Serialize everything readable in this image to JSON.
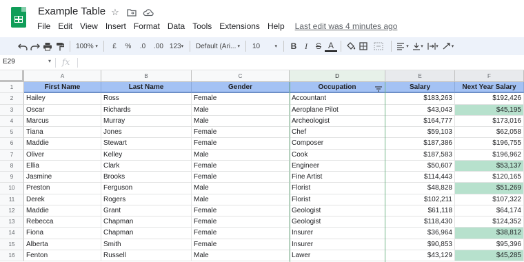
{
  "app": {
    "title": "Example Table",
    "menus": [
      "File",
      "Edit",
      "View",
      "Insert",
      "Format",
      "Data",
      "Tools",
      "Extensions",
      "Help"
    ],
    "last_edit": "Last edit was 4 minutes ago"
  },
  "toolbar": {
    "zoom": "100%",
    "currency": "£",
    "percent": "%",
    "dec_decrease": ".0",
    "dec_increase": ".00",
    "format_more": "123",
    "font": "Default (Ari...",
    "font_size": "10",
    "bold": "B",
    "italic": "I",
    "strike": "S",
    "text_color": "A"
  },
  "formula": {
    "name_box": "E29",
    "fx": "fx"
  },
  "columns": [
    "A",
    "B",
    "C",
    "D",
    "E",
    "F"
  ],
  "row_numbers": [
    "1",
    "2",
    "3",
    "4",
    "5",
    "6",
    "7",
    "8",
    "9",
    "10",
    "11",
    "12",
    "13",
    "14",
    "15",
    "16"
  ],
  "headers": [
    "First Name",
    "Last Name",
    "Gender",
    "Occupation",
    "Salary",
    "Next Year Salary"
  ],
  "rows": [
    [
      "Hailey",
      "Ross",
      "Female",
      "Accountant",
      "$183,263",
      "$192,426"
    ],
    [
      "Oscar",
      "Richards",
      "Male",
      "Aeroplane Pilot",
      "$43,043",
      "$45,195"
    ],
    [
      "Marcus",
      "Murray",
      "Male",
      "Archeologist",
      "$164,777",
      "$173,016"
    ],
    [
      "Tiana",
      "Jones",
      "Female",
      "Chef",
      "$59,103",
      "$62,058"
    ],
    [
      "Maddie",
      "Stewart",
      "Female",
      "Composer",
      "$187,386",
      "$196,755"
    ],
    [
      "Oliver",
      "Kelley",
      "Male",
      "Cook",
      "$187,583",
      "$196,962"
    ],
    [
      "Ellia",
      "Clark",
      "Female",
      "Engineer",
      "$50,607",
      "$53,137"
    ],
    [
      "Jasmine",
      "Brooks",
      "Female",
      "Fine Artist",
      "$114,443",
      "$120,165"
    ],
    [
      "Preston",
      "Ferguson",
      "Male",
      "Florist",
      "$48,828",
      "$51,269"
    ],
    [
      "Derek",
      "Rogers",
      "Male",
      "Florist",
      "$102,211",
      "$107,322"
    ],
    [
      "Maddie",
      "Grant",
      "Female",
      "Geologist",
      "$61,118",
      "$64,174"
    ],
    [
      "Rebecca",
      "Chapman",
      "Female",
      "Geologist",
      "$118,430",
      "$124,352"
    ],
    [
      "Fiona",
      "Chapman",
      "Female",
      "Insurer",
      "$36,964",
      "$38,812"
    ],
    [
      "Alberta",
      "Smith",
      "Female",
      "Insurer",
      "$90,853",
      "$95,396"
    ],
    [
      "Fenton",
      "Russell",
      "Male",
      "Lawer",
      "$43,129",
      "$45,285"
    ]
  ],
  "highlighted_rows": [
    1,
    6,
    8,
    12,
    14
  ],
  "colors": {
    "header_bg": "#a4c2f4",
    "highlight_green": "#b7e1cd",
    "selected_column": "#6fb586",
    "sheets_green": "#0f9d58"
  }
}
